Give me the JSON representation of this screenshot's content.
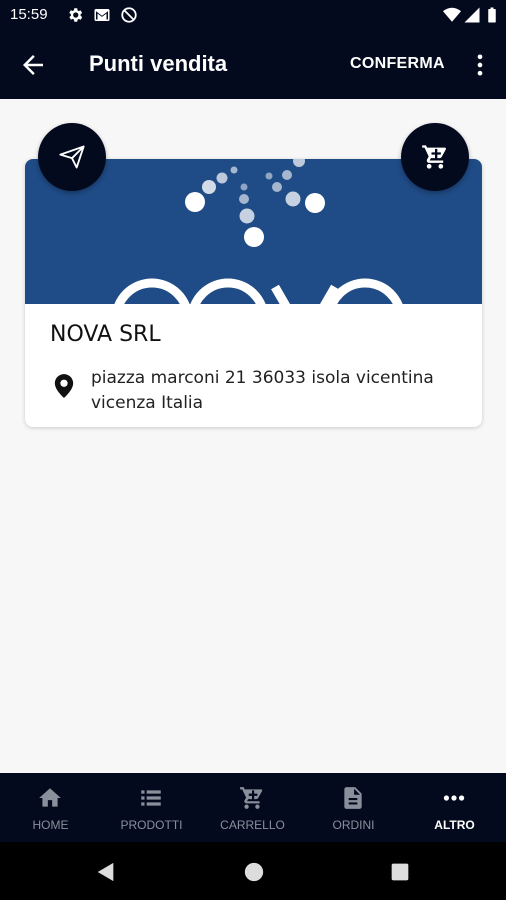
{
  "status_bar": {
    "time": "15:59",
    "icons": [
      "settings-icon",
      "gmail-icon",
      "sync-off-icon",
      "wifi-icon",
      "signal-icon",
      "battery-icon"
    ]
  },
  "app_bar": {
    "title": "Punti vendita",
    "confirm_label": "CONFERMA",
    "back_icon": "arrow-back-icon",
    "more_icon": "more-vert-icon"
  },
  "store_card": {
    "name": "NOVA SRL",
    "address": "piazza marconi 21 36033 isola vicentina vicenza Italia",
    "banner_color": "#1f4b86",
    "send_icon": "send-icon",
    "cart_icon": "cart-icon",
    "location_icon": "location-pin-icon"
  },
  "bottom_nav": {
    "items": [
      {
        "label": "HOME",
        "icon": "home-icon"
      },
      {
        "label": "PRODOTTI",
        "icon": "list-icon"
      },
      {
        "label": "CARRELLO",
        "icon": "cart-icon"
      },
      {
        "label": "ORDINI",
        "icon": "document-icon"
      },
      {
        "label": "ALTRO",
        "icon": "more-horiz-icon"
      }
    ],
    "active_index": 4
  },
  "colors": {
    "primary_dark": "#040a1e",
    "background": "#f7f7f7",
    "nav_inactive": "#8a8f9c",
    "nav_active": "#ffffff"
  }
}
